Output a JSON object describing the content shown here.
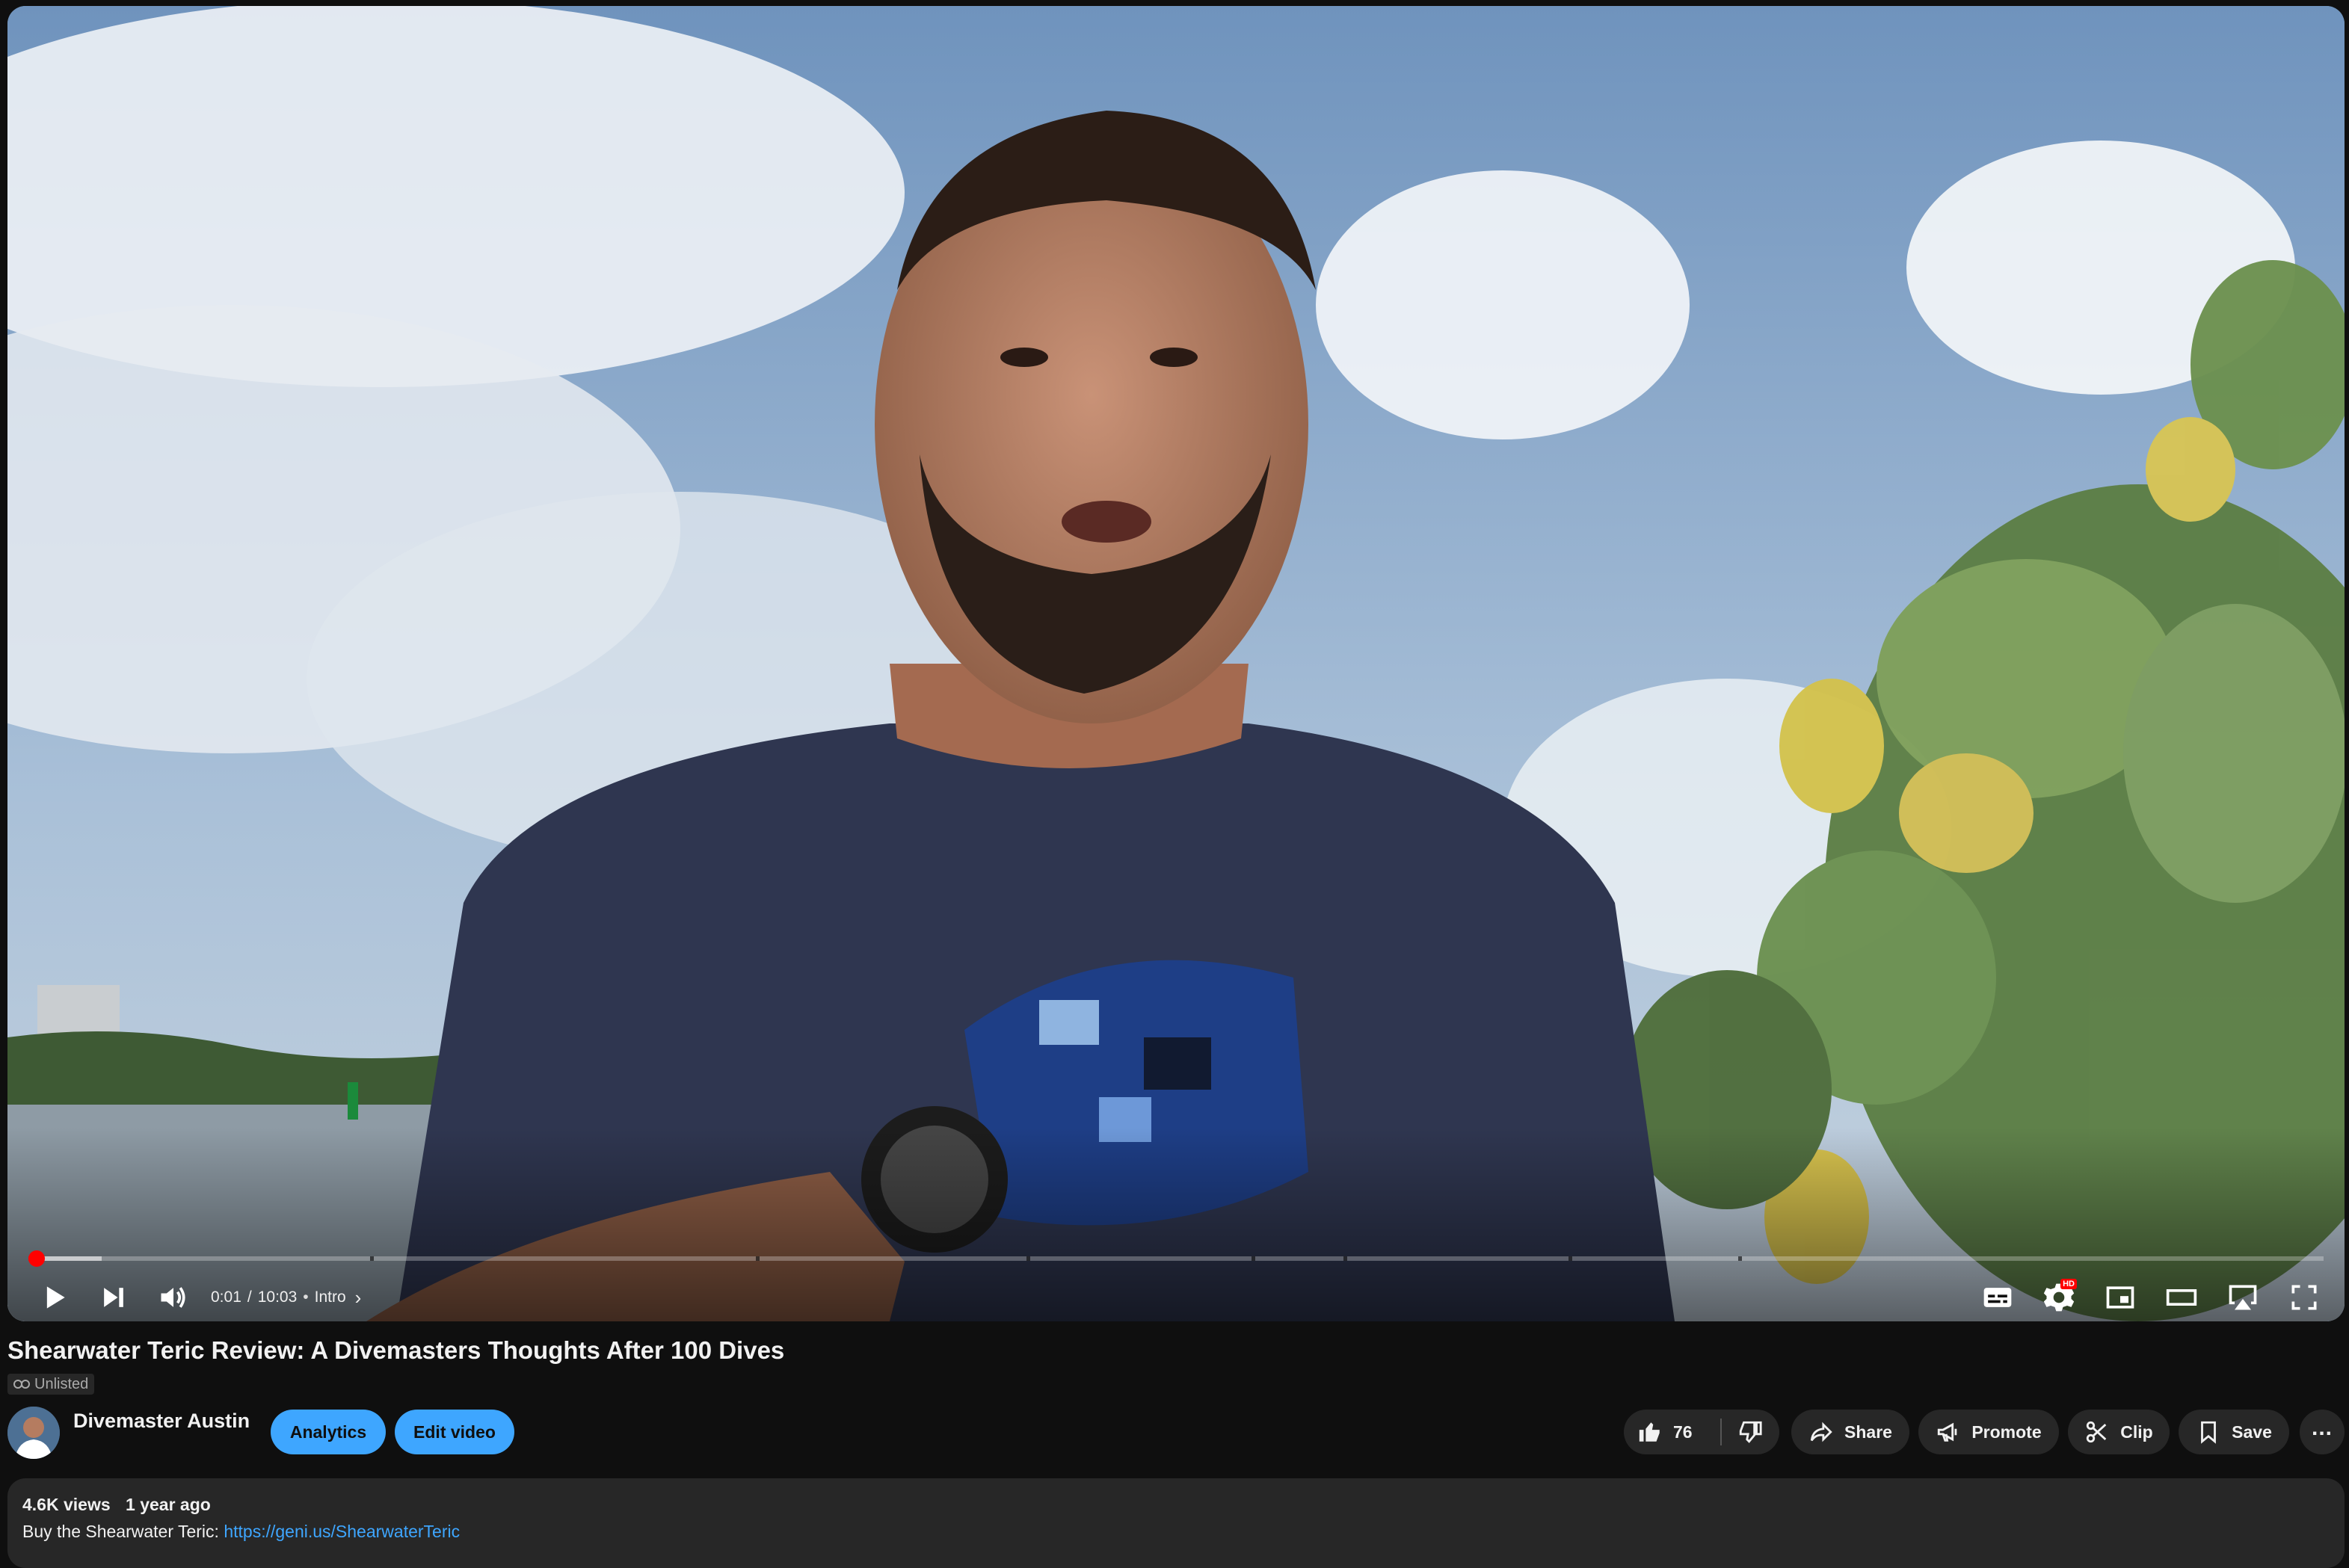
{
  "player": {
    "current_time": "0:01",
    "separator": "/",
    "duration": "10:03",
    "chapter_separator": "•",
    "chapter": "Intro",
    "progress_fraction": 0.002,
    "buffered_fraction": 0.032,
    "hd_badge": "HD",
    "accent_color": "#ff0000",
    "icons": [
      "play-icon",
      "next-icon",
      "volume-icon",
      "chevron-right-icon",
      "subtitles-icon",
      "settings-icon",
      "miniplayer-icon",
      "theater-mode-icon",
      "airplay-icon",
      "fullscreen-icon"
    ]
  },
  "video": {
    "title": "Shearwater Teric Review: A Divemasters Thoughts After 100 Dives",
    "visibility": "Unlisted"
  },
  "channel": {
    "name": "Divemaster Austin"
  },
  "actions": {
    "analytics_label": "Analytics",
    "edit_video_label": "Edit video",
    "like_count": "76",
    "share_label": "Share",
    "promote_label": "Promote",
    "clip_label": "Clip",
    "save_label": "Save",
    "more_label": "...",
    "accent_color": "#3ea6ff"
  },
  "description": {
    "views": "4.6K views",
    "age": "1 year ago",
    "text_prefix": "Buy the Shearwater Teric: ",
    "link": "https://geni.us/ShearwaterTeric"
  }
}
